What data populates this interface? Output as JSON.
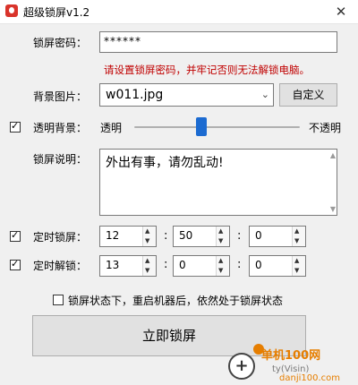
{
  "window": {
    "title": "超级锁屏v1.2",
    "close_glyph": "✕"
  },
  "password": {
    "label": "锁屏密码：",
    "value": "******",
    "hint": "请设置锁屏密码，并牢记否则无法解锁电脑。"
  },
  "background": {
    "label": "背景图片：",
    "selected": "w011.jpg",
    "custom_button": "自定义"
  },
  "transparency": {
    "checked": true,
    "label": "透明背景：",
    "left_label": "透明",
    "right_label": "不透明",
    "level_percent": 45
  },
  "description": {
    "label": "锁屏说明：",
    "text": "外出有事，请勿乱动!"
  },
  "timed_lock": {
    "checked": true,
    "label": "定时锁屏：",
    "hour": "12",
    "minute": "50",
    "second": "0"
  },
  "timed_unlock": {
    "checked": true,
    "label": "定时解锁：",
    "hour": "13",
    "minute": "0",
    "second": "0"
  },
  "persist": {
    "checked": false,
    "label": "锁屏状态下，重启机器后，依然处于锁屏状态"
  },
  "lock_now_button": "立即锁屏",
  "colon": ":",
  "watermark": {
    "main": "单机100网",
    "sub": "ty(Visin)",
    "site": "danji100.com",
    "plus": "+"
  },
  "colors": {
    "accent": "#1c6bd1",
    "warning": "#c00000",
    "watermark": "#e67e00"
  }
}
